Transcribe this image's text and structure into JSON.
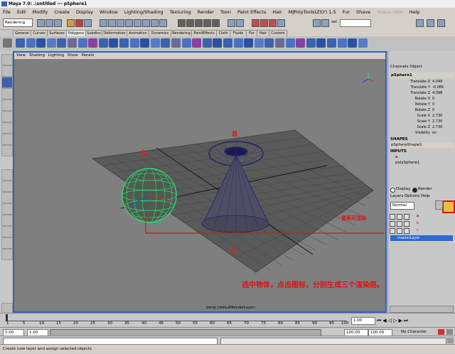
{
  "window": {
    "title": "Maya 7.0: .\\untitled  ---  pSphere1"
  },
  "menubar": [
    "File",
    "Edit",
    "Modify",
    "Create",
    "Display",
    "Window",
    "Lighting/Shading",
    "Texturing",
    "Render",
    "Toon",
    "Paint Effects",
    "Hair",
    "MJPolyTools(ZSY) 1.5",
    "Fur",
    "Shave",
    "Shave Utils",
    "Help"
  ],
  "statusline": {
    "mode": "Rendering",
    "field_label": "sel",
    "field_value": ""
  },
  "shelf_tabs": [
    "General",
    "Curves",
    "Surfaces",
    "Polygons",
    "Subdivs",
    "Deformation",
    "Animation",
    "Dynamics",
    "Rendering",
    "PaintEffects",
    "Cloth",
    "Fluids",
    "Fur",
    "Hair",
    "Custom"
  ],
  "viewport": {
    "menu": [
      "View",
      "Shading",
      "Lighting",
      "Show",
      "Panels"
    ],
    "camera_label": "persp (defaultRenderLayer)",
    "labels": {
      "a": "A",
      "b": "B",
      "c": "C"
    },
    "annotation_small": "鼠表可渲染",
    "annotation_large": "选中物体，点击图标，分别生成三个渲染层。"
  },
  "channel_box": {
    "tabs": [
      "Channels",
      "Object"
    ],
    "object": "pSphere1",
    "attrs": [
      {
        "k": "Translate X",
        "v": "4.049"
      },
      {
        "k": "Translate Y",
        "v": "-0.066"
      },
      {
        "k": "Translate Z",
        "v": "4.098"
      },
      {
        "k": "Rotate X",
        "v": "0"
      },
      {
        "k": "Rotate Y",
        "v": "0"
      },
      {
        "k": "Rotate Z",
        "v": "0"
      },
      {
        "k": "Scale X",
        "v": "2.730"
      },
      {
        "k": "Scale Y",
        "v": "2.730"
      },
      {
        "k": "Scale Z",
        "v": "2.730"
      },
      {
        "k": "Visibility",
        "v": "on"
      }
    ],
    "shapes_label": "SHAPES",
    "shape": "pSphereShape1",
    "inputs_label": "INPUTS",
    "inputs": [
      "a",
      "polySphere1"
    ]
  },
  "layers": {
    "display": "Display",
    "render": "Render",
    "menu": [
      "Layers",
      "Options",
      "Help"
    ],
    "blend": "Normal",
    "rows": [
      "a",
      "b",
      "c"
    ],
    "master": "masterLayer"
  },
  "timeslider": {
    "ticks": [
      "1",
      "5",
      "10",
      "15",
      "20",
      "25",
      "30",
      "35",
      "40",
      "45",
      "50",
      "55",
      "60",
      "65",
      "70",
      "75",
      "80",
      "85",
      "90",
      "95",
      "100"
    ],
    "current": "1.00"
  },
  "rangeslider": {
    "start": "1.00",
    "start2": "1.00",
    "end": "100.00",
    "end2": "100.00",
    "char": "No Character Set"
  },
  "helpline": "Create new layer and assign selected objects"
}
